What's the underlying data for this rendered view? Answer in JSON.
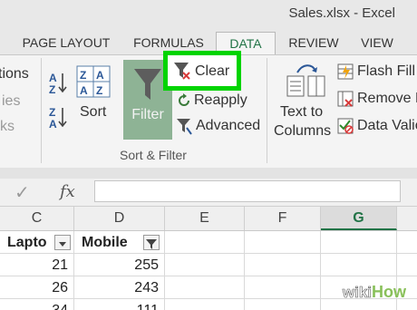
{
  "window": {
    "title": "Sales.xlsx - Excel"
  },
  "tabs": [
    {
      "label": "PAGE LAYOUT"
    },
    {
      "label": "FORMULAS"
    },
    {
      "label": "DATA"
    },
    {
      "label": "REVIEW"
    },
    {
      "label": "VIEW"
    }
  ],
  "ribbon": {
    "left_partial": [
      "tions",
      "ies",
      "ks"
    ],
    "sort_label": "Sort",
    "filter_label": "Filter",
    "clear_label": "Clear",
    "reapply_label": "Reapply",
    "advanced_label": "Advanced",
    "group_label": "Sort & Filter",
    "text_to_columns": [
      "Text to",
      "Columns"
    ],
    "flash_fill": "Flash Fill",
    "remove_dup": "Remove D",
    "data_valid": "Data Valic"
  },
  "formula_bar": {
    "fx": "fx",
    "check": "✓"
  },
  "columns": [
    "C",
    "D",
    "E",
    "F",
    "G"
  ],
  "rows": [
    {
      "c": "Lapto",
      "d": "Mobile"
    },
    {
      "c": "21",
      "d": "255"
    },
    {
      "c": "26",
      "d": "243"
    },
    {
      "c": "34",
      "d": "111"
    }
  ],
  "watermark": {
    "part1": "wiki",
    "part2": "How"
  },
  "colors": {
    "accent": "#217346",
    "highlight": "#00d400",
    "filter_bg": "#8eb395"
  }
}
